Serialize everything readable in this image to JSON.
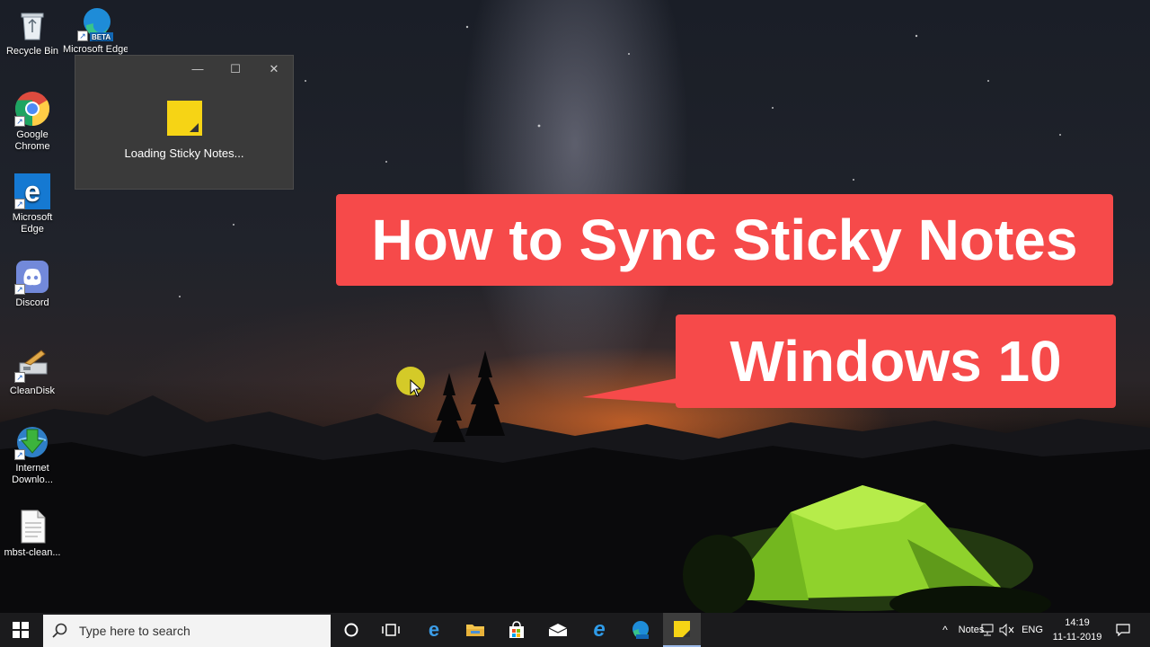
{
  "desktop": {
    "icons": [
      {
        "label": "Recycle Bin",
        "icon": "recycle-bin-icon"
      },
      {
        "label": "Microsoft Edge Beta",
        "icon": "edge-beta-icon",
        "badge": "BETA"
      },
      {
        "label": "Google\nChrome",
        "icon": "chrome-icon"
      },
      {
        "label": "Microsoft\nEdge",
        "icon": "edge-icon"
      },
      {
        "label": "Discord",
        "icon": "discord-icon"
      },
      {
        "label": "CleanDisk",
        "icon": "cleandisk-icon"
      },
      {
        "label": "Internet\nDownlo...",
        "icon": "idm-icon"
      },
      {
        "label": "mbst-clean...",
        "icon": "text-file-icon"
      }
    ]
  },
  "loading_window": {
    "text": "Loading Sticky Notes...",
    "minimize": "—",
    "maximize": "☐",
    "close": "✕"
  },
  "banners": {
    "title": "How to Sync Sticky Notes",
    "subtitle": "Windows 10"
  },
  "taskbar": {
    "search_placeholder": "Type here to search",
    "apps": [
      "task-view",
      "edge",
      "file-explorer",
      "microsoft-store",
      "mail",
      "internet-explorer",
      "edge-beta",
      "sticky-notes"
    ],
    "tray": {
      "notes": "Notes",
      "language": "ENG",
      "time": "14:19",
      "date": "11-11-2019"
    }
  },
  "colors": {
    "banner": "#f64a4a",
    "sticky": "#f6d415",
    "taskbar": "#1b1b1d"
  }
}
